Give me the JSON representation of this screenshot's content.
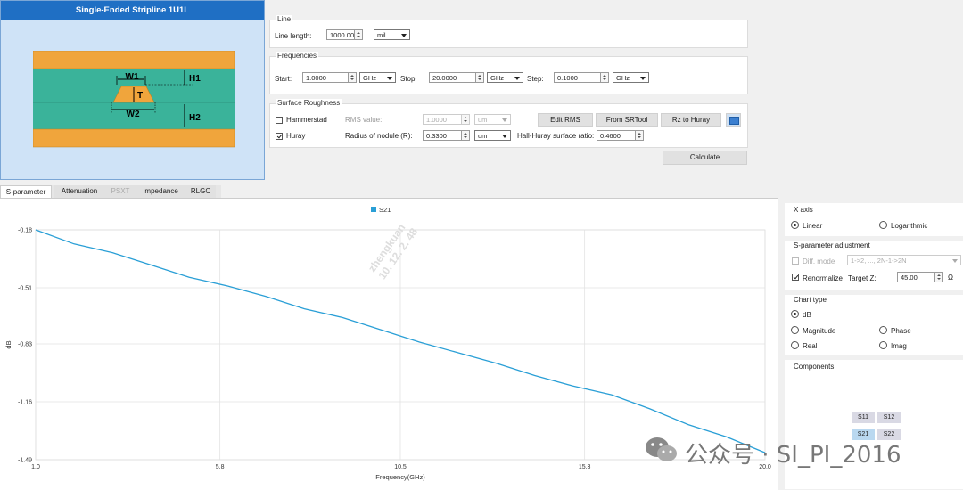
{
  "preview": {
    "title": "Single-Ended Stripline 1U1L",
    "labels": {
      "w1": "W1",
      "w2": "W2",
      "t": "T",
      "h1": "H1",
      "h2": "H2"
    }
  },
  "line": {
    "title": "Line",
    "length_label": "Line length:",
    "length_value": "1000.00",
    "unit": "mil"
  },
  "frequencies": {
    "title": "Frequencies",
    "start_label": "Start:",
    "start_value": "1.0000",
    "start_unit": "GHz",
    "stop_label": "Stop:",
    "stop_value": "20.0000",
    "stop_unit": "GHz",
    "step_label": "Step:",
    "step_value": "0.1000",
    "step_unit": "GHz"
  },
  "roughness": {
    "title": "Surface Roughness",
    "hammerstad_label": "Hammerstad",
    "rms_label": "RMS value:",
    "rms_value": "1.0000",
    "rms_unit": "um",
    "edit_rms": "Edit RMS",
    "from_srtool": "From SRTool",
    "rz_to_huray": "Rz to Huray",
    "huray_label": "Huray",
    "radius_label": "Radius of nodule (R):",
    "radius_value": "0.3300",
    "radius_unit": "um",
    "ratio_label": "Hall-Huray surface ratio:",
    "ratio_value": "0.4600"
  },
  "calculate": "Calculate",
  "tabs": [
    "S-parameter",
    "Attenuation",
    "PSXT",
    "Impedance",
    "RLGC"
  ],
  "chart_data": {
    "type": "line",
    "legend": "S21",
    "xlabel": "Frequency(GHz)",
    "ylabel": "dB",
    "xlim": [
      1.0,
      20.0
    ],
    "ylim": [
      -1.49,
      -0.18
    ],
    "xticks": [
      "1.0",
      "5.8",
      "10.5",
      "15.3",
      "20.0"
    ],
    "yticks": [
      "-0.18",
      "-0.51",
      "-0.83",
      "-1.16",
      "-1.49"
    ],
    "series": [
      {
        "name": "S21",
        "color": "#2a9fd6",
        "x": [
          1.0,
          2.0,
          3.0,
          4.0,
          5.0,
          6.0,
          7.0,
          8.0,
          9.0,
          10.0,
          11.0,
          12.0,
          13.0,
          14.0,
          15.0,
          16.0,
          17.0,
          18.0,
          19.0,
          20.0
        ],
        "y": [
          -0.18,
          -0.26,
          -0.31,
          -0.38,
          -0.45,
          -0.5,
          -0.56,
          -0.63,
          -0.68,
          -0.75,
          -0.82,
          -0.88,
          -0.94,
          -1.01,
          -1.07,
          -1.12,
          -1.2,
          -1.29,
          -1.36,
          -1.45
        ]
      }
    ],
    "grid": true
  },
  "watermark": {
    "line1": "zhengkuan",
    "line2": "10. 12. 2. 48",
    "brand": "公众号 · SI_PI_2016"
  },
  "xaxis": {
    "title": "X axis",
    "linear": "Linear",
    "log": "Logarithmic"
  },
  "sadj": {
    "title": "S-parameter adjustment",
    "diff_label": "Diff. mode",
    "diff_value": "1->2, ..., 2N-1->2N",
    "renorm_label": "Renormalize",
    "target_label": "Target Z:",
    "target_value": "45.00",
    "ohm": "Ω"
  },
  "charttype": {
    "title": "Chart type",
    "db": "dB",
    "magnitude": "Magnitude",
    "phase": "Phase",
    "real": "Real",
    "imag": "Imag"
  },
  "components": {
    "title": "Components",
    "items": [
      "S11",
      "S12",
      "S21",
      "S22"
    ]
  }
}
